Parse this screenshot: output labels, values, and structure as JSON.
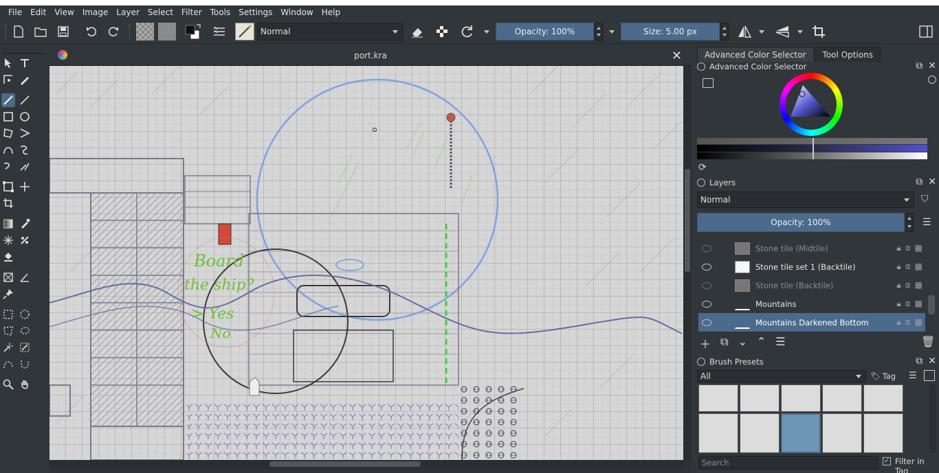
{
  "window": {
    "doc_title": "port.kra"
  },
  "menu": [
    "File",
    "Edit",
    "View",
    "Image",
    "Layer",
    "Select",
    "Filter",
    "Tools",
    "Settings",
    "Window",
    "Help"
  ],
  "toolbar": {
    "blend_mode": "Normal",
    "opacity_label": "Opacity: 100%",
    "size_label": "Size: 5.00 px"
  },
  "panels": {
    "tabs": [
      "Advanced Color Selector",
      "Tool Options"
    ],
    "color_selector_title": "Advanced Color Selector",
    "layers_title": "Layers",
    "layers_blend": "Normal",
    "layers_opacity": "Opacity:  100%",
    "layers": [
      {
        "name": "Stone tile (Midtile)",
        "visible": false
      },
      {
        "name": "Stone tile set 1 (Backtile)",
        "visible": true
      },
      {
        "name": "Stone tile (Backtile)",
        "visible": false
      },
      {
        "name": "Mountains",
        "visible": true
      },
      {
        "name": "Mountains Darkened Bottom",
        "visible": true,
        "selected": true
      }
    ],
    "brush_presets_title": "Brush Presets",
    "brush_filter": "All",
    "tag_label": "Tag",
    "search_placeholder": "Search",
    "filter_in_tag": "Filter in Tag"
  },
  "canvas_text": {
    "line1": "Board",
    "line2": "the ship?",
    "line3": "> Yes",
    "line4": "No"
  },
  "colors": {
    "accent": "#4b6a8c",
    "panel_bg": "#31363b",
    "canvas_bg": "#d6d6d6",
    "ink_green": "#6fbf3a"
  }
}
